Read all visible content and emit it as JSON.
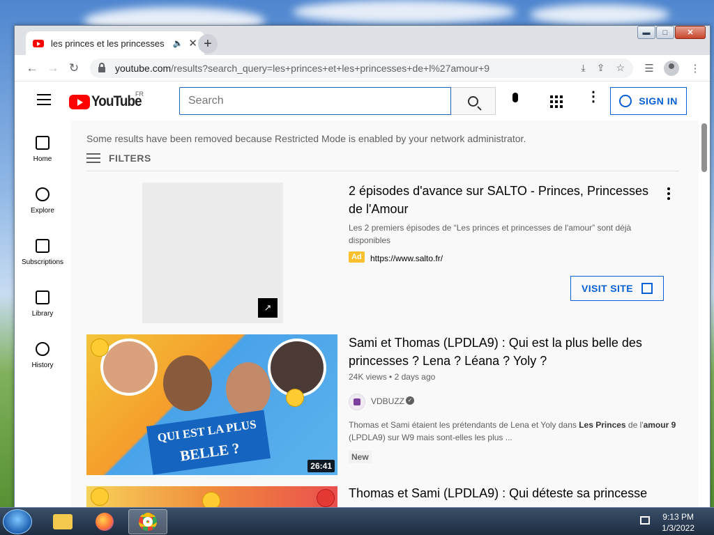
{
  "browser": {
    "tab_title": "les princes et les princesses",
    "tab_close": "✕",
    "new_tab": "+",
    "window_controls": {
      "minimize": "▬",
      "maximize": "□",
      "close": "✕"
    },
    "nav": {
      "back": "←",
      "forward": "→",
      "reload": "↻"
    },
    "url_host": "youtube.com",
    "url_path": "/results?search_query=les+princes+et+les+princesses+de+l%27amour+9",
    "toolbar_icons": [
      "download-icon",
      "share-icon",
      "bookmark-star-icon",
      "reading-list-icon",
      "profile-icon",
      "more-icon"
    ]
  },
  "youtube": {
    "logo_text": "YouTube",
    "country_code": "FR",
    "search_placeholder": "Search",
    "sign_in": "SIGN IN",
    "guide": [
      {
        "label": "Home",
        "icon": "home-icon"
      },
      {
        "label": "Explore",
        "icon": "compass-icon"
      },
      {
        "label": "Subscriptions",
        "icon": "subscriptions-icon"
      },
      {
        "label": "Library",
        "icon": "library-icon"
      },
      {
        "label": "History",
        "icon": "history-icon"
      }
    ],
    "notice": "Some results have been removed because Restricted Mode is enabled by your network administrator.",
    "filters_label": "FILTERS",
    "ad": {
      "title": "2 épisodes d'avance sur SALTO - Princes, Princesses de l'Amour",
      "description": "Les 2 premiers épisodes de “Les princes et princesses de l'amour” sont déjà disponibles",
      "badge": "Ad",
      "url": "https://www.salto.fr/",
      "cta": "VISIT SITE"
    },
    "results": [
      {
        "title": "Sami et Thomas (LPDLA9) : Qui est la plus belle des princesses ? Lena ? Léana ? Yoly ?",
        "views": "24K views",
        "age": "2 days ago",
        "channel": "VDBUZZ",
        "verified": true,
        "description_parts": [
          "Thomas et Sami étaient les prétendants de Lena et Yoly dans ",
          "Les Princes",
          " de l'",
          "amour 9",
          " (LPDLA9) sur W9 mais sont-elles les plus ..."
        ],
        "badge": "New",
        "duration": "26:41",
        "thumb_text_1": "QUI EST LA PLUS",
        "thumb_text_2": "BELLE ?"
      },
      {
        "title": "Thomas et Sami (LPDLA9) : Qui déteste sa princesse"
      }
    ]
  },
  "taskbar": {
    "time": "9:13 PM",
    "date": "1/3/2022",
    "apps": [
      "file-explorer-icon",
      "firefox-icon",
      "chrome-icon"
    ]
  }
}
